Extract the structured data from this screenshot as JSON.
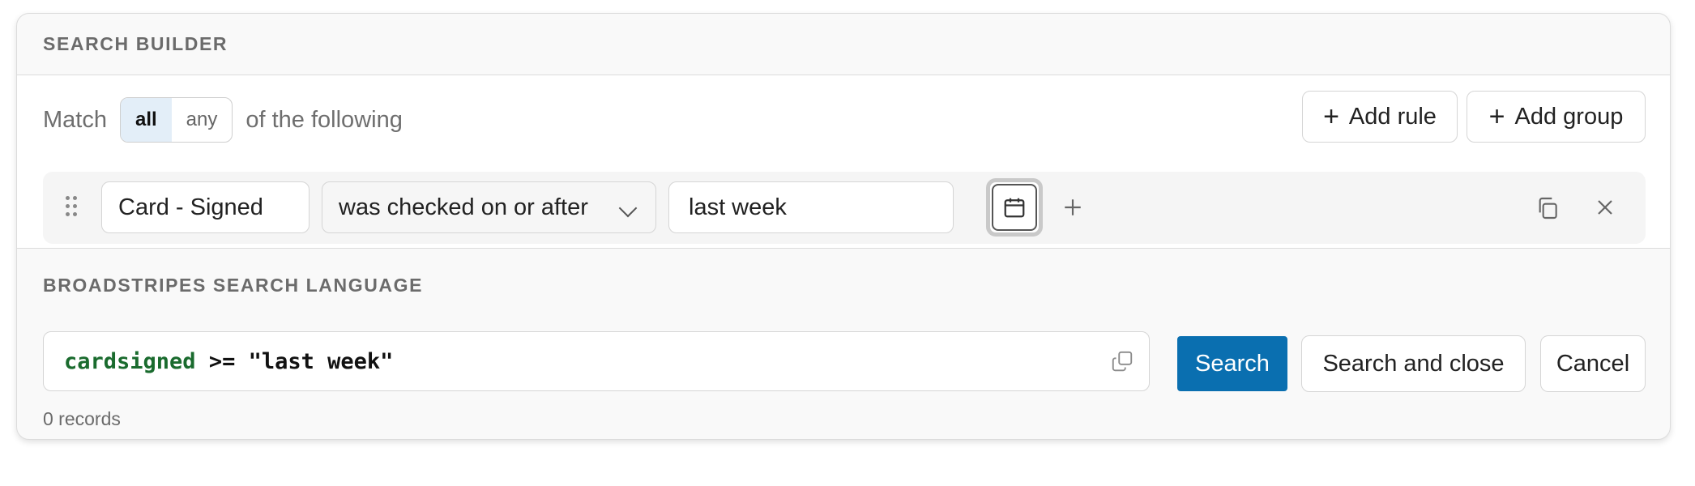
{
  "header": {
    "title": "SEARCH BUILDER"
  },
  "match": {
    "prefix": "Match",
    "options": [
      "all",
      "any"
    ],
    "selected": "all",
    "suffix": "of the following"
  },
  "actions": {
    "add_rule": "Add rule",
    "add_group": "Add group"
  },
  "rule": {
    "field": "Card - Signed",
    "operator": "was checked on or after",
    "value": "last week"
  },
  "language": {
    "title": "BROADSTRIPES SEARCH LANGUAGE",
    "code_field": "cardsigned",
    "code_rest": " >= \"last week\"",
    "search": "Search",
    "search_close": "Search and close",
    "cancel": "Cancel",
    "records": "0 records"
  },
  "colors": {
    "primary": "#0a6fb0",
    "code_field": "#1a6b2e",
    "toggle_active": "#e3eef8"
  },
  "icons": [
    "drag-handle-icon",
    "chevron-down-icon",
    "calendar-icon",
    "plus-icon",
    "duplicate-icon",
    "close-icon",
    "copy-icon"
  ]
}
